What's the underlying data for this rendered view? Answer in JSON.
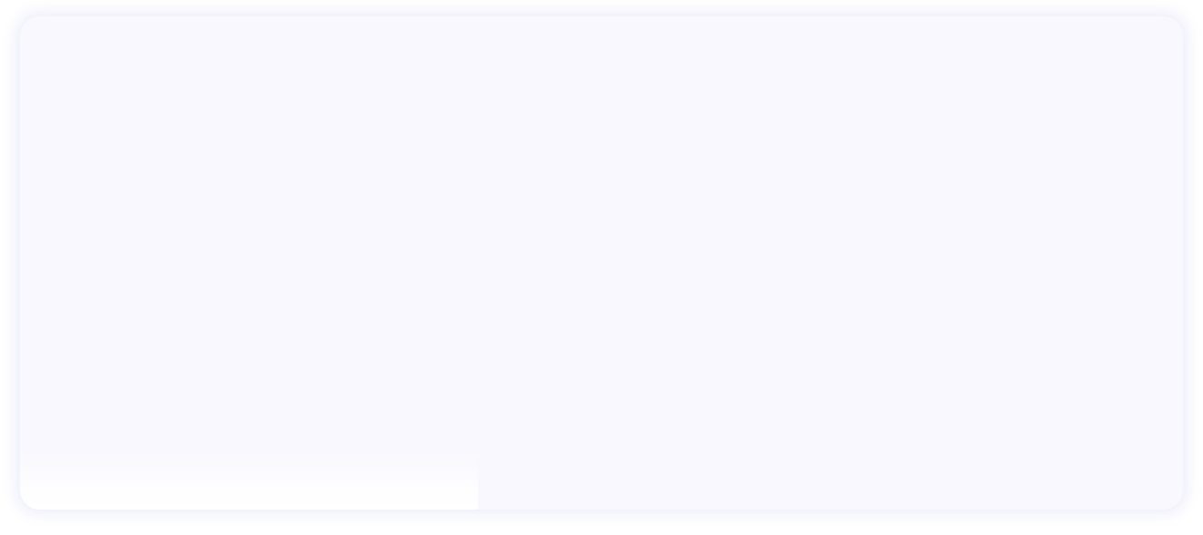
{
  "colors": {
    "page_background": "#ffffff",
    "card_background": "#f8f8fe",
    "card_glow": "#ececfc",
    "fade_end": "#ffffff"
  },
  "card": {
    "content": ""
  }
}
